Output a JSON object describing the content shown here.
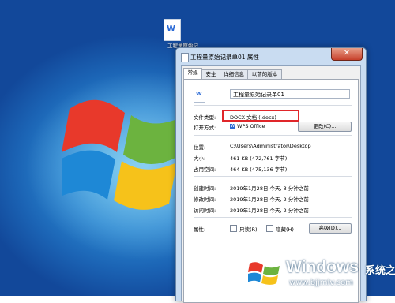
{
  "desktop": {
    "file_icon": {
      "label": "工程量原始记",
      "icon": "wps-doc-icon"
    }
  },
  "dialog": {
    "title": "工程量原始记录单01 属性",
    "close_glyph": "✕",
    "tabs": [
      {
        "label": "常规",
        "active": true
      },
      {
        "label": "安全",
        "active": false
      },
      {
        "label": "详细信息",
        "active": false
      },
      {
        "label": "以前的版本",
        "active": false
      }
    ],
    "general": {
      "file_name": "工程量原始记录单01",
      "file_type_label": "文件类型:",
      "file_type_value": "DOCX 文档 (.docx)",
      "open_with_label": "打开方式:",
      "open_with_value": "WPS Office",
      "change_button": "更改(C)...",
      "location_label": "位置:",
      "location_value": "C:\\Users\\Administrator\\Desktop",
      "size_label": "大小:",
      "size_value": "461 KB (472,761 字节)",
      "size_on_disk_label": "占用空间:",
      "size_on_disk_value": "464 KB (475,136 字节)",
      "created_label": "创建时间:",
      "created_value": "2019年1月28日 今天, 3 分钟之前",
      "modified_label": "修改时间:",
      "modified_value": "2019年1月28日 今天, 2 分钟之前",
      "accessed_label": "访问时间:",
      "accessed_value": "2019年1月28日 今天, 2 分钟之前",
      "attributes_label": "属性:",
      "readonly_label": "只读(R)",
      "hidden_label": "隐藏(H)",
      "advanced_button": "高级(D)..."
    }
  },
  "watermark": {
    "brand": "Windows",
    "cn": "系统之家",
    "url": "www.bjjmlv.com"
  }
}
